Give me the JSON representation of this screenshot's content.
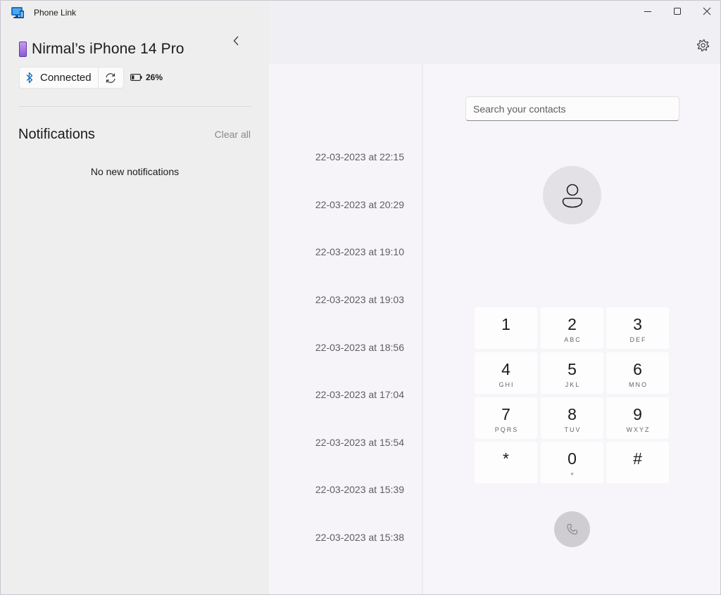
{
  "app": {
    "title": "Phone Link"
  },
  "device": {
    "name": "Nirmal’s iPhone 14 Pro",
    "status": "Connected",
    "battery": "26%"
  },
  "notifications": {
    "title": "Notifications",
    "clear_all": "Clear all",
    "empty": "No new notifications"
  },
  "calls": [
    "22-03-2023 at 22:15",
    "22-03-2023 at 20:29",
    "22-03-2023 at 19:10",
    "22-03-2023 at 19:03",
    "22-03-2023 at 18:56",
    "22-03-2023 at 17:04",
    "22-03-2023 at 15:54",
    "22-03-2023 at 15:39",
    "22-03-2023 at 15:38"
  ],
  "dialer": {
    "search_placeholder": "Search your contacts",
    "keys": [
      {
        "digit": "1",
        "letters": ""
      },
      {
        "digit": "2",
        "letters": "ABC"
      },
      {
        "digit": "3",
        "letters": "DEF"
      },
      {
        "digit": "4",
        "letters": "GHI"
      },
      {
        "digit": "5",
        "letters": "JKL"
      },
      {
        "digit": "6",
        "letters": "MNO"
      },
      {
        "digit": "7",
        "letters": "PQRS"
      },
      {
        "digit": "8",
        "letters": "TUV"
      },
      {
        "digit": "9",
        "letters": "WXYZ"
      },
      {
        "digit": "*",
        "letters": ""
      },
      {
        "digit": "0",
        "letters": "+"
      },
      {
        "digit": "#",
        "letters": ""
      }
    ]
  },
  "icons": {
    "app": "phone-link-icon",
    "collapse": "chevron-left-icon",
    "bluetooth": "bluetooth-icon",
    "sync": "sync-icon",
    "battery": "battery-icon",
    "settings": "gear-icon",
    "contact": "person-icon",
    "call": "phone-icon"
  },
  "colors": {
    "accent_bluetooth": "#0f6cbd",
    "phone_purple": "#8a5ad8",
    "left_panel": "#eeeeee",
    "call_button_disabled": "#cfcdd1"
  }
}
